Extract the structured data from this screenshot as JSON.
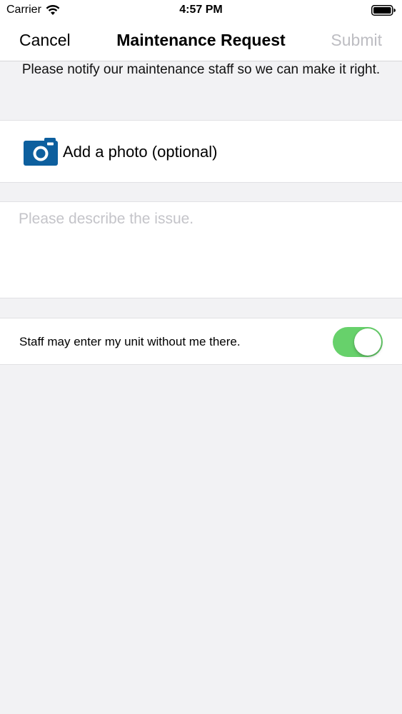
{
  "status_bar": {
    "carrier": "Carrier",
    "time": "4:57 PM",
    "wifi_icon": "wifi-icon",
    "battery_icon": "battery-icon"
  },
  "nav": {
    "cancel_label": "Cancel",
    "title": "Maintenance Request",
    "submit_label": "Submit"
  },
  "intro_text": "Please notify our maintenance staff so we can make it right.",
  "photo": {
    "label": "Add a photo (optional)",
    "icon": "camera-icon",
    "icon_color": "#0d5f9e"
  },
  "description": {
    "value": "",
    "placeholder": "Please describe the issue."
  },
  "entry_permission": {
    "label": "Staff may enter my unit without me there.",
    "enabled": true,
    "on_color": "#67d16b"
  },
  "colors": {
    "background": "#f2f2f4",
    "disabled_text": "#bdbdc2"
  }
}
